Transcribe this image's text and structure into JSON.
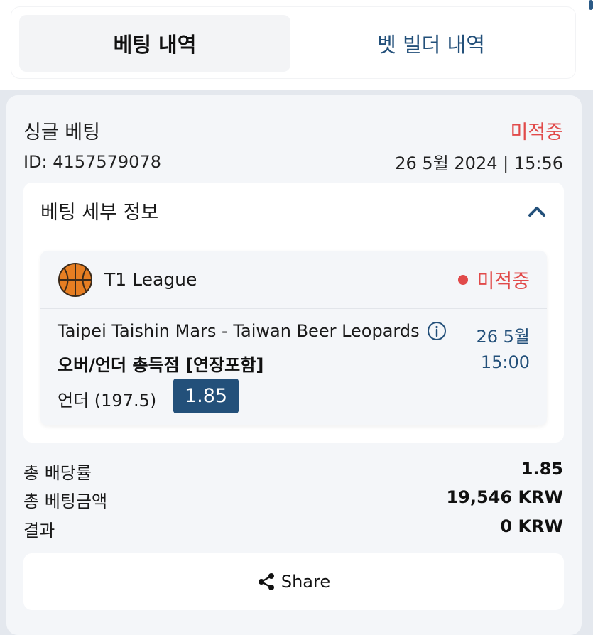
{
  "tabs": [
    {
      "label": "베팅 내역",
      "active": true
    },
    {
      "label": "벳 빌더 내역",
      "active": false
    }
  ],
  "bet": {
    "type": "싱글 베팅",
    "status": "미적중",
    "id": "ID: 4157579078",
    "datetime": "26 5월 2024 | 15:56"
  },
  "details": {
    "title": "베팅 세부 정보",
    "league": "T1 League",
    "sport_icon": "basketball-icon",
    "status": "미적중",
    "match": "Taipei Taishin Mars - Taiwan Beer Leopards",
    "date": "26 5월",
    "time": "15:00",
    "market": "오버/언더 총득점 [연장포함]",
    "pick": "언더 (197.5)",
    "odds": "1.85"
  },
  "summary": {
    "total_odds_label": "총 배당률",
    "total_odds_value": "1.85",
    "stake_label": "총 베팅금액",
    "stake_value": "19,546 KRW",
    "result_label": "결과",
    "result_value": "0 KRW"
  },
  "share": {
    "label": "Share"
  },
  "colors": {
    "accent": "#23507a",
    "loss": "#e14a4a",
    "card_bg": "#f4f6f9"
  }
}
